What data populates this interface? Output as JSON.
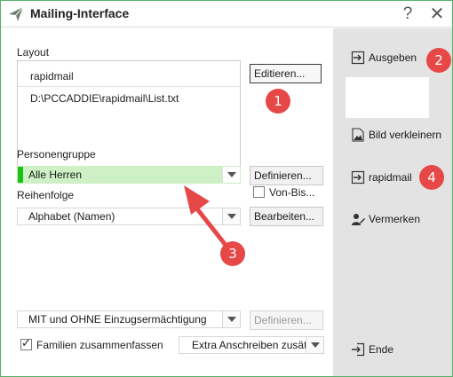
{
  "window": {
    "title": "Mailing-Interface",
    "help_glyph": "?",
    "close_glyph": "✕"
  },
  "layout": {
    "label": "Layout",
    "items": [
      "rapidmail",
      "D:\\PCCADDIE\\rapidmail\\List.txt"
    ],
    "edit_button": "Editieren..."
  },
  "personengruppe": {
    "label": "Personengruppe",
    "value": "Alle Herren",
    "define_button": "Definieren...",
    "von_bis_label": "Von-Bis..."
  },
  "reihenfolge": {
    "label": "Reihenfolge",
    "value": "Alphabet (Namen)",
    "edit_button": "Bearbeiten..."
  },
  "einzug": {
    "value": "MIT und OHNE Einzugsermächtigung",
    "define_button": "Definieren..."
  },
  "familien": {
    "label": "Familien zusammenfassen",
    "checked": true,
    "extra_value": "Extra Anschreiben zusätzl"
  },
  "side": {
    "ausgeben": "Ausgeben",
    "bild_verkleinern": "Bild verkleinern",
    "rapidmail": "rapidmail",
    "vermerken": "Vermerken",
    "ende": "Ende"
  },
  "annotations": {
    "one": "1",
    "two": "2",
    "three": "3",
    "four": "4"
  },
  "colors": {
    "accent_green": "#16c414",
    "badge_red": "#e64848",
    "selection_green": "#cdf0c4"
  }
}
